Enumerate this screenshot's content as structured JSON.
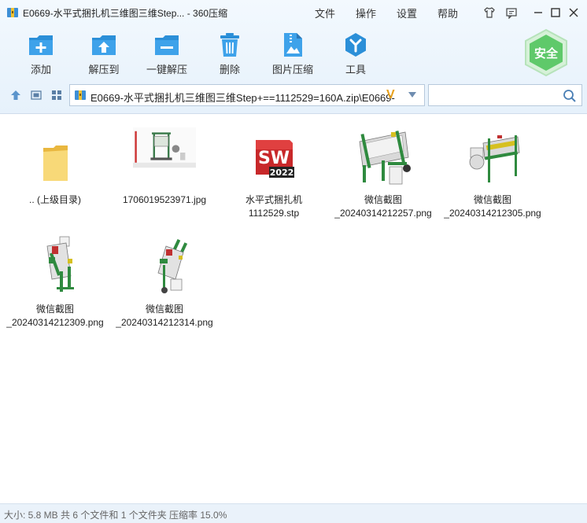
{
  "window": {
    "title": "E0669-水平式捆扎机三维图三维Step... - 360压缩"
  },
  "menu": [
    "文件",
    "操作",
    "设置",
    "帮助"
  ],
  "toolbar": {
    "add": "添加",
    "extract_to": "解压到",
    "one_click_extract": "一键解压",
    "delete": "删除",
    "image_compress": "图片压缩",
    "tools": "工具"
  },
  "safe_badge": "安全",
  "address": {
    "path": "E0669-水平式捆扎机三维图三维Step+==1112529=160A.zip\\E0669-",
    "search_placeholder": ""
  },
  "files": [
    {
      "name": ".. (上级目录)",
      "type": "folder-up"
    },
    {
      "name": "1706019523971.jpg",
      "type": "jpg"
    },
    {
      "name": "水平式捆扎机\n1112529.stp",
      "type": "stp",
      "badge": "SW",
      "badge_year": "2022"
    },
    {
      "name": "微信截图\n_20240314212257.png",
      "type": "png"
    },
    {
      "name": "微信截图\n_20240314212305.png",
      "type": "png"
    },
    {
      "name": "微信截图\n_20240314212309.png",
      "type": "png"
    },
    {
      "name": "微信截图\n_20240314212314.png",
      "type": "png"
    }
  ],
  "status": "大小: 5.8 MB 共 6 个文件和 1 个文件夹 压缩率 15.0%",
  "colors": {
    "accent_blue": "#2b8fd8",
    "safe_green": "#5fc96a",
    "machine_green": "#2f8a3f"
  }
}
